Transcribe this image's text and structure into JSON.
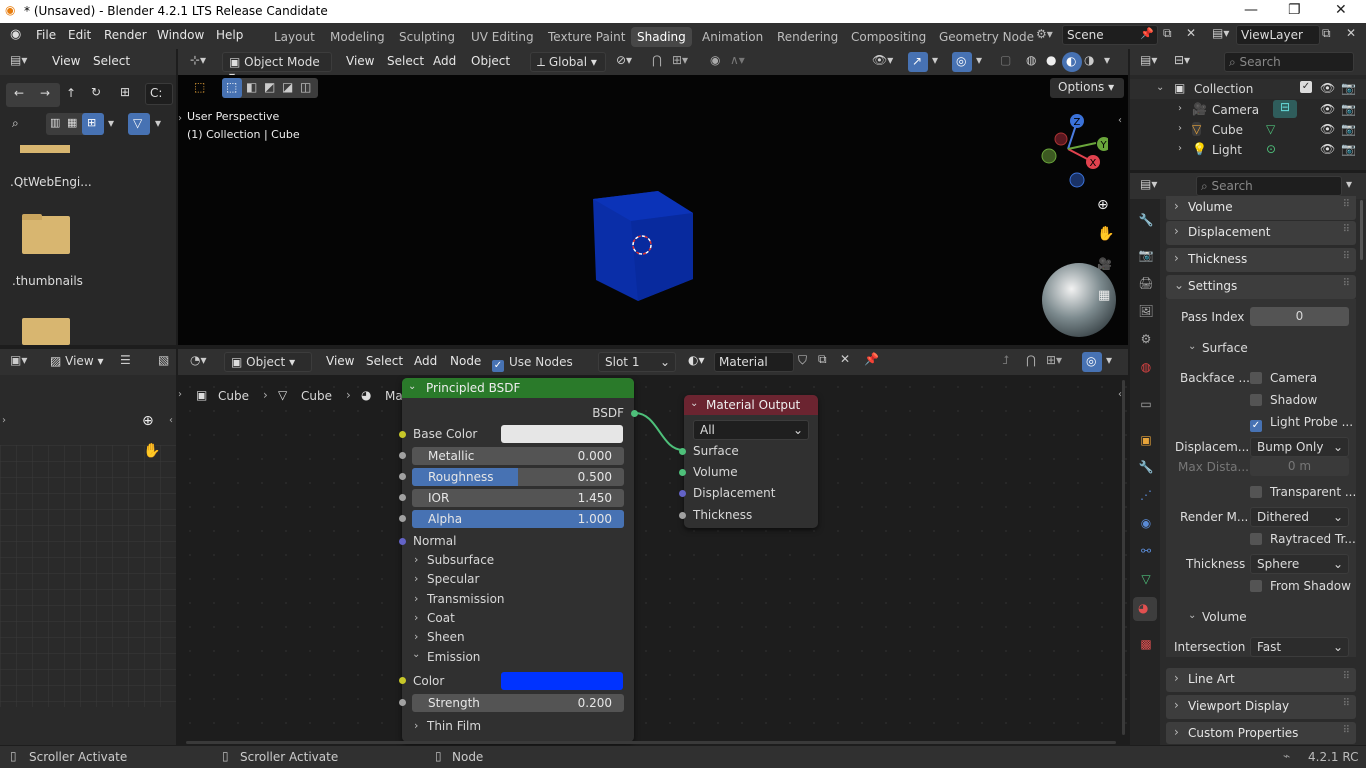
{
  "window": {
    "title": "* (Unsaved) - Blender 4.2.1 LTS Release Candidate",
    "minimize": "—",
    "maximize": "❐",
    "close": "✕"
  },
  "menu": {
    "file": "File",
    "edit": "Edit",
    "render": "Render",
    "window": "Window",
    "help": "Help"
  },
  "workspaces": [
    "Layout",
    "Modeling",
    "Sculpting",
    "UV Editing",
    "Texture Paint",
    "Shading",
    "Animation",
    "Rendering",
    "Compositing",
    "Geometry Node"
  ],
  "active_workspace": "Shading",
  "scene": {
    "name": "Scene",
    "view_layer": "ViewLayer"
  },
  "file_browser": {
    "view": "View",
    "select": "Select",
    "path": "C:",
    "items": [
      ".QtWebEngi...",
      ".thumbnails"
    ]
  },
  "viewport": {
    "mode": "Object Mode",
    "view": "View",
    "select": "Select",
    "add": "Add",
    "object": "Object",
    "orientation": "Global",
    "options": "Options",
    "overlay_title": "User Perspective",
    "overlay_sub": "(1) Collection | Cube",
    "axes": {
      "x": "X",
      "y": "Y",
      "z": "Z"
    }
  },
  "outliner": {
    "search": "Search",
    "collection": "Collection",
    "items": [
      "Camera",
      "Cube",
      "Light"
    ]
  },
  "properties": {
    "search": "Search",
    "sections_top": [
      "Volume",
      "Displacement",
      "Thickness",
      "Settings"
    ],
    "pass_index_label": "Pass Index",
    "pass_index": "0",
    "surface": "Surface",
    "backface_label": "Backface ...",
    "camera": "Camera",
    "shadow": "Shadow",
    "light_probe": "Light Probe ...",
    "displacement_label": "Displacem...",
    "displacement_value": "Bump Only",
    "max_dist_label": "Max Dista...",
    "max_dist_value": "0 m",
    "transparent": "Transparent ...",
    "render_method_label": "Render M...",
    "render_method_value": "Dithered",
    "raytraced": "Raytraced Tr...",
    "thickness_label": "Thickness",
    "thickness_value": "Sphere",
    "from_shadow": "From Shadow",
    "volume": "Volume",
    "intersection_label": "Intersection",
    "intersection_value": "Fast",
    "sections_bottom": [
      "Line Art",
      "Viewport Display",
      "Custom Properties"
    ]
  },
  "image_editor": {
    "view": "View"
  },
  "node_editor": {
    "type": "Object",
    "view": "View",
    "select": "Select",
    "add": "Add",
    "node": "Node",
    "use_nodes": "Use Nodes",
    "slot": "Slot 1",
    "material": "Material",
    "breadcrumb": [
      "Cube",
      "Cube",
      "Material"
    ]
  },
  "bsdf_node": {
    "title": "Principled BSDF",
    "output": "BSDF",
    "base_color_label": "Base Color",
    "base_color": "#e6e6e6",
    "metallic_label": "Metallic",
    "metallic": "0.000",
    "metallic_fill": 0.0,
    "roughness_label": "Roughness",
    "roughness": "0.500",
    "roughness_fill": 0.5,
    "ior_label": "IOR",
    "ior": "1.450",
    "ior_fill": 0.0,
    "alpha_label": "Alpha",
    "alpha": "1.000",
    "alpha_fill": 1.0,
    "normal": "Normal",
    "panels": [
      "Subsurface",
      "Specular",
      "Transmission",
      "Coat",
      "Sheen"
    ],
    "emission": "Emission",
    "color_label": "Color",
    "emission_color": "#0033ff",
    "strength_label": "Strength",
    "strength": "0.200",
    "thin_film": "Thin Film"
  },
  "output_node": {
    "title": "Material Output",
    "target": "All",
    "inputs": [
      "Surface",
      "Volume",
      "Displacement",
      "Thickness"
    ]
  },
  "status": {
    "left": "Scroller Activate",
    "mid": "Scroller Activate",
    "right": "Node",
    "version": "4.2.1 RC"
  },
  "colors": {
    "accent": "#4772b3",
    "cube": "#0a2ea8",
    "bsdf_header": "#2a7a2a",
    "output_header": "#6b2430"
  }
}
